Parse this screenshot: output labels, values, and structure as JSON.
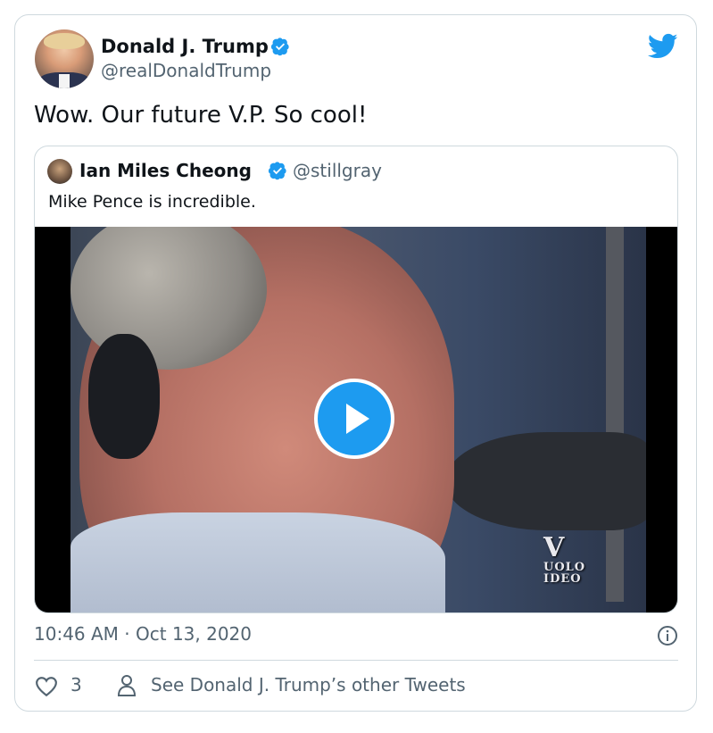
{
  "author": {
    "name": "Donald J. Trump",
    "handle": "@realDonaldTrump"
  },
  "tweet": {
    "text": "Wow. Our future V.P. So cool!"
  },
  "quoted_tweet": {
    "name": "Ian Miles Cheong",
    "handle": "@stillgray",
    "text": "Mike Pence is incredible.",
    "video_watermark_line1": "UOLO",
    "video_watermark_line2": "IDEO"
  },
  "meta": {
    "timestamp": "10:46 AM · Oct 13, 2020"
  },
  "actions": {
    "like_count": "3",
    "other_tweets_label": "See Donald J. Trump’s other Tweets"
  },
  "colors": {
    "accent": "#1d9bf0",
    "secondary_text": "#536471",
    "border": "#cfd9de"
  },
  "icons": {
    "verified": "verified-badge-icon",
    "brand": "twitter-bird-icon",
    "info": "info-icon",
    "like": "heart-icon",
    "profile": "person-icon",
    "play": "play-icon"
  }
}
